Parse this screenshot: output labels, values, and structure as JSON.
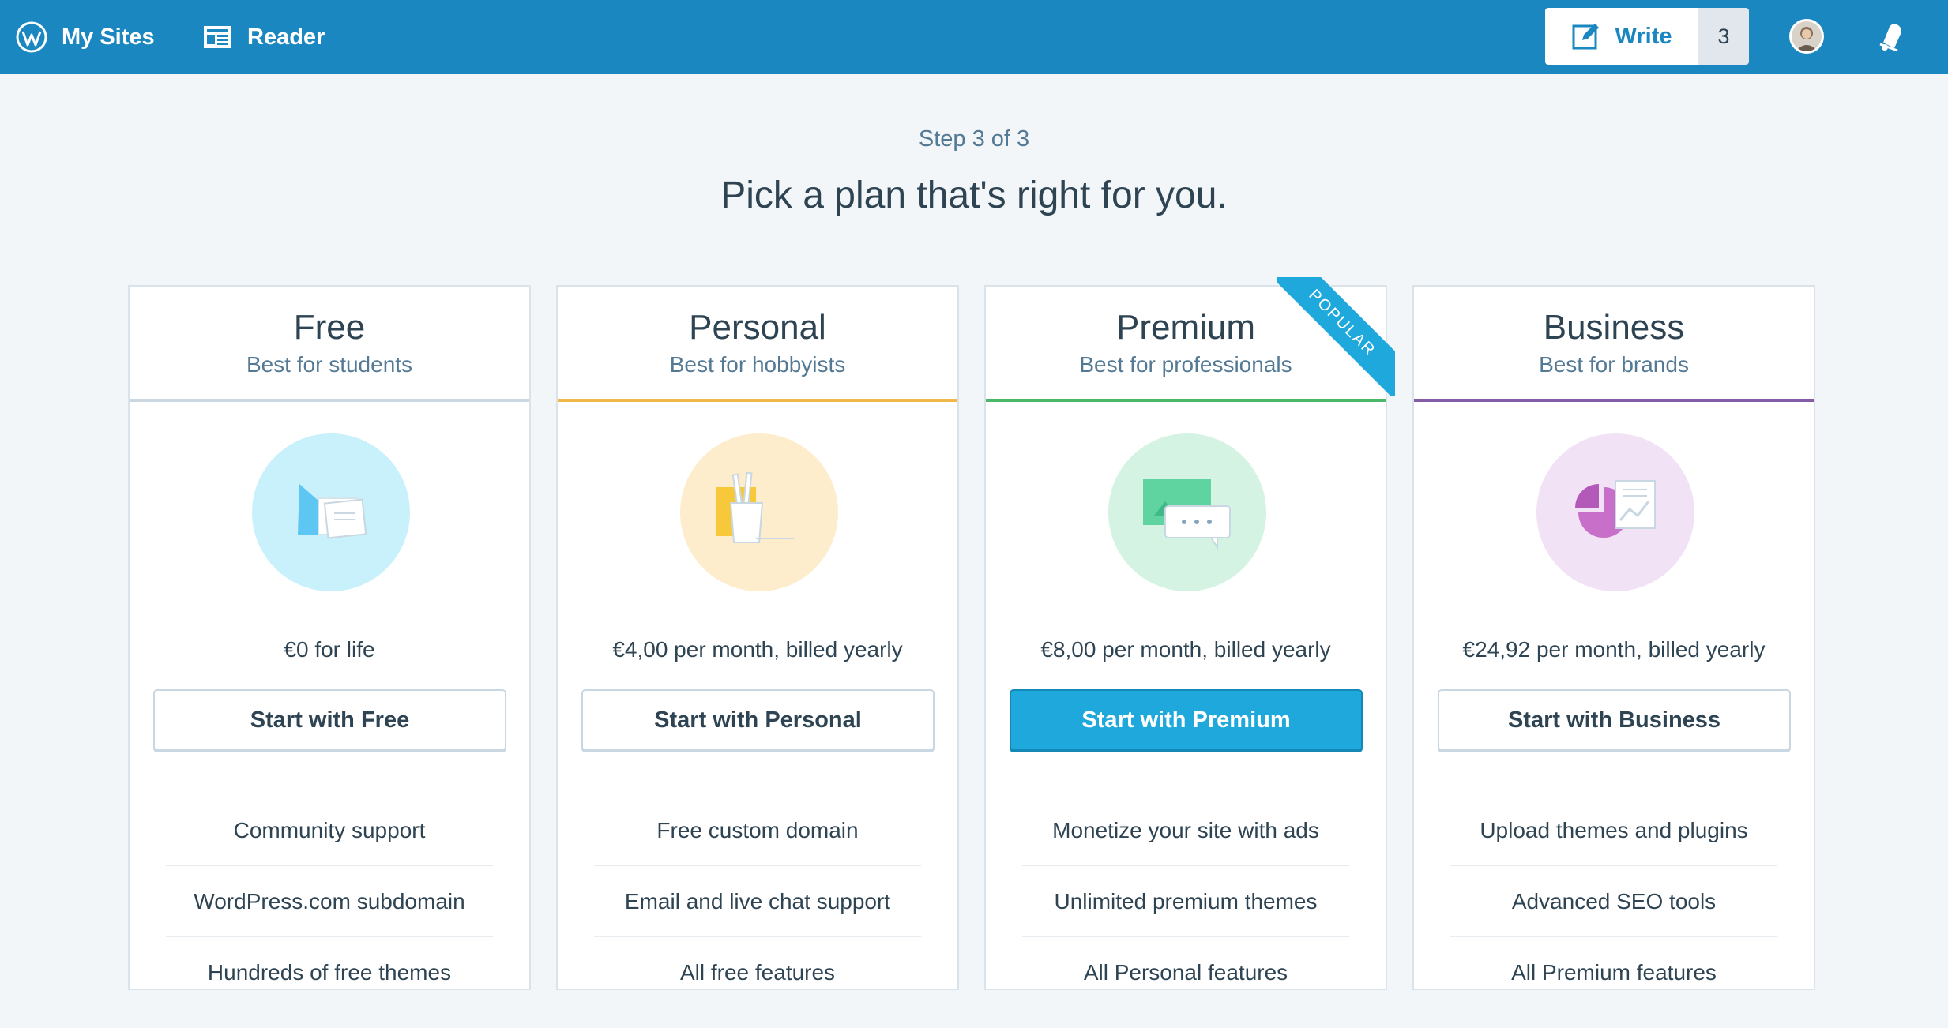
{
  "masterbar": {
    "my_sites": "My Sites",
    "reader": "Reader",
    "write": "Write",
    "write_count": "3"
  },
  "header": {
    "step": "Step 3 of 3",
    "title": "Pick a plan that's right for you."
  },
  "colors": {
    "masterbar": "#1a87c1",
    "primary_button": "#1fa8dc",
    "free_accent": "#c8d7e1",
    "personal_accent": "#f0b849",
    "premium_accent": "#4ab866",
    "business_accent": "#855da6"
  },
  "plans": [
    {
      "name": "Free",
      "tagline": "Best for students",
      "price": "€0 for life",
      "cta": "Start with Free",
      "features": [
        "Community support",
        "WordPress.com subdomain",
        "Hundreds of free themes"
      ]
    },
    {
      "name": "Personal",
      "tagline": "Best for hobbyists",
      "price": "€4,00 per month, billed yearly",
      "cta": "Start with Personal",
      "features": [
        "Free custom domain",
        "Email and live chat support",
        "All free features"
      ]
    },
    {
      "name": "Premium",
      "tagline": "Best for professionals",
      "price": "€8,00 per month, billed yearly",
      "cta": "Start with Premium",
      "badge": "POPULAR",
      "features": [
        "Monetize your site with ads",
        "Unlimited premium themes",
        "All Personal features"
      ]
    },
    {
      "name": "Business",
      "tagline": "Best for brands",
      "price": "€24,92 per month, billed yearly",
      "cta": "Start with Business",
      "features": [
        "Upload themes and plugins",
        "Advanced SEO tools",
        "All Premium features"
      ]
    }
  ]
}
